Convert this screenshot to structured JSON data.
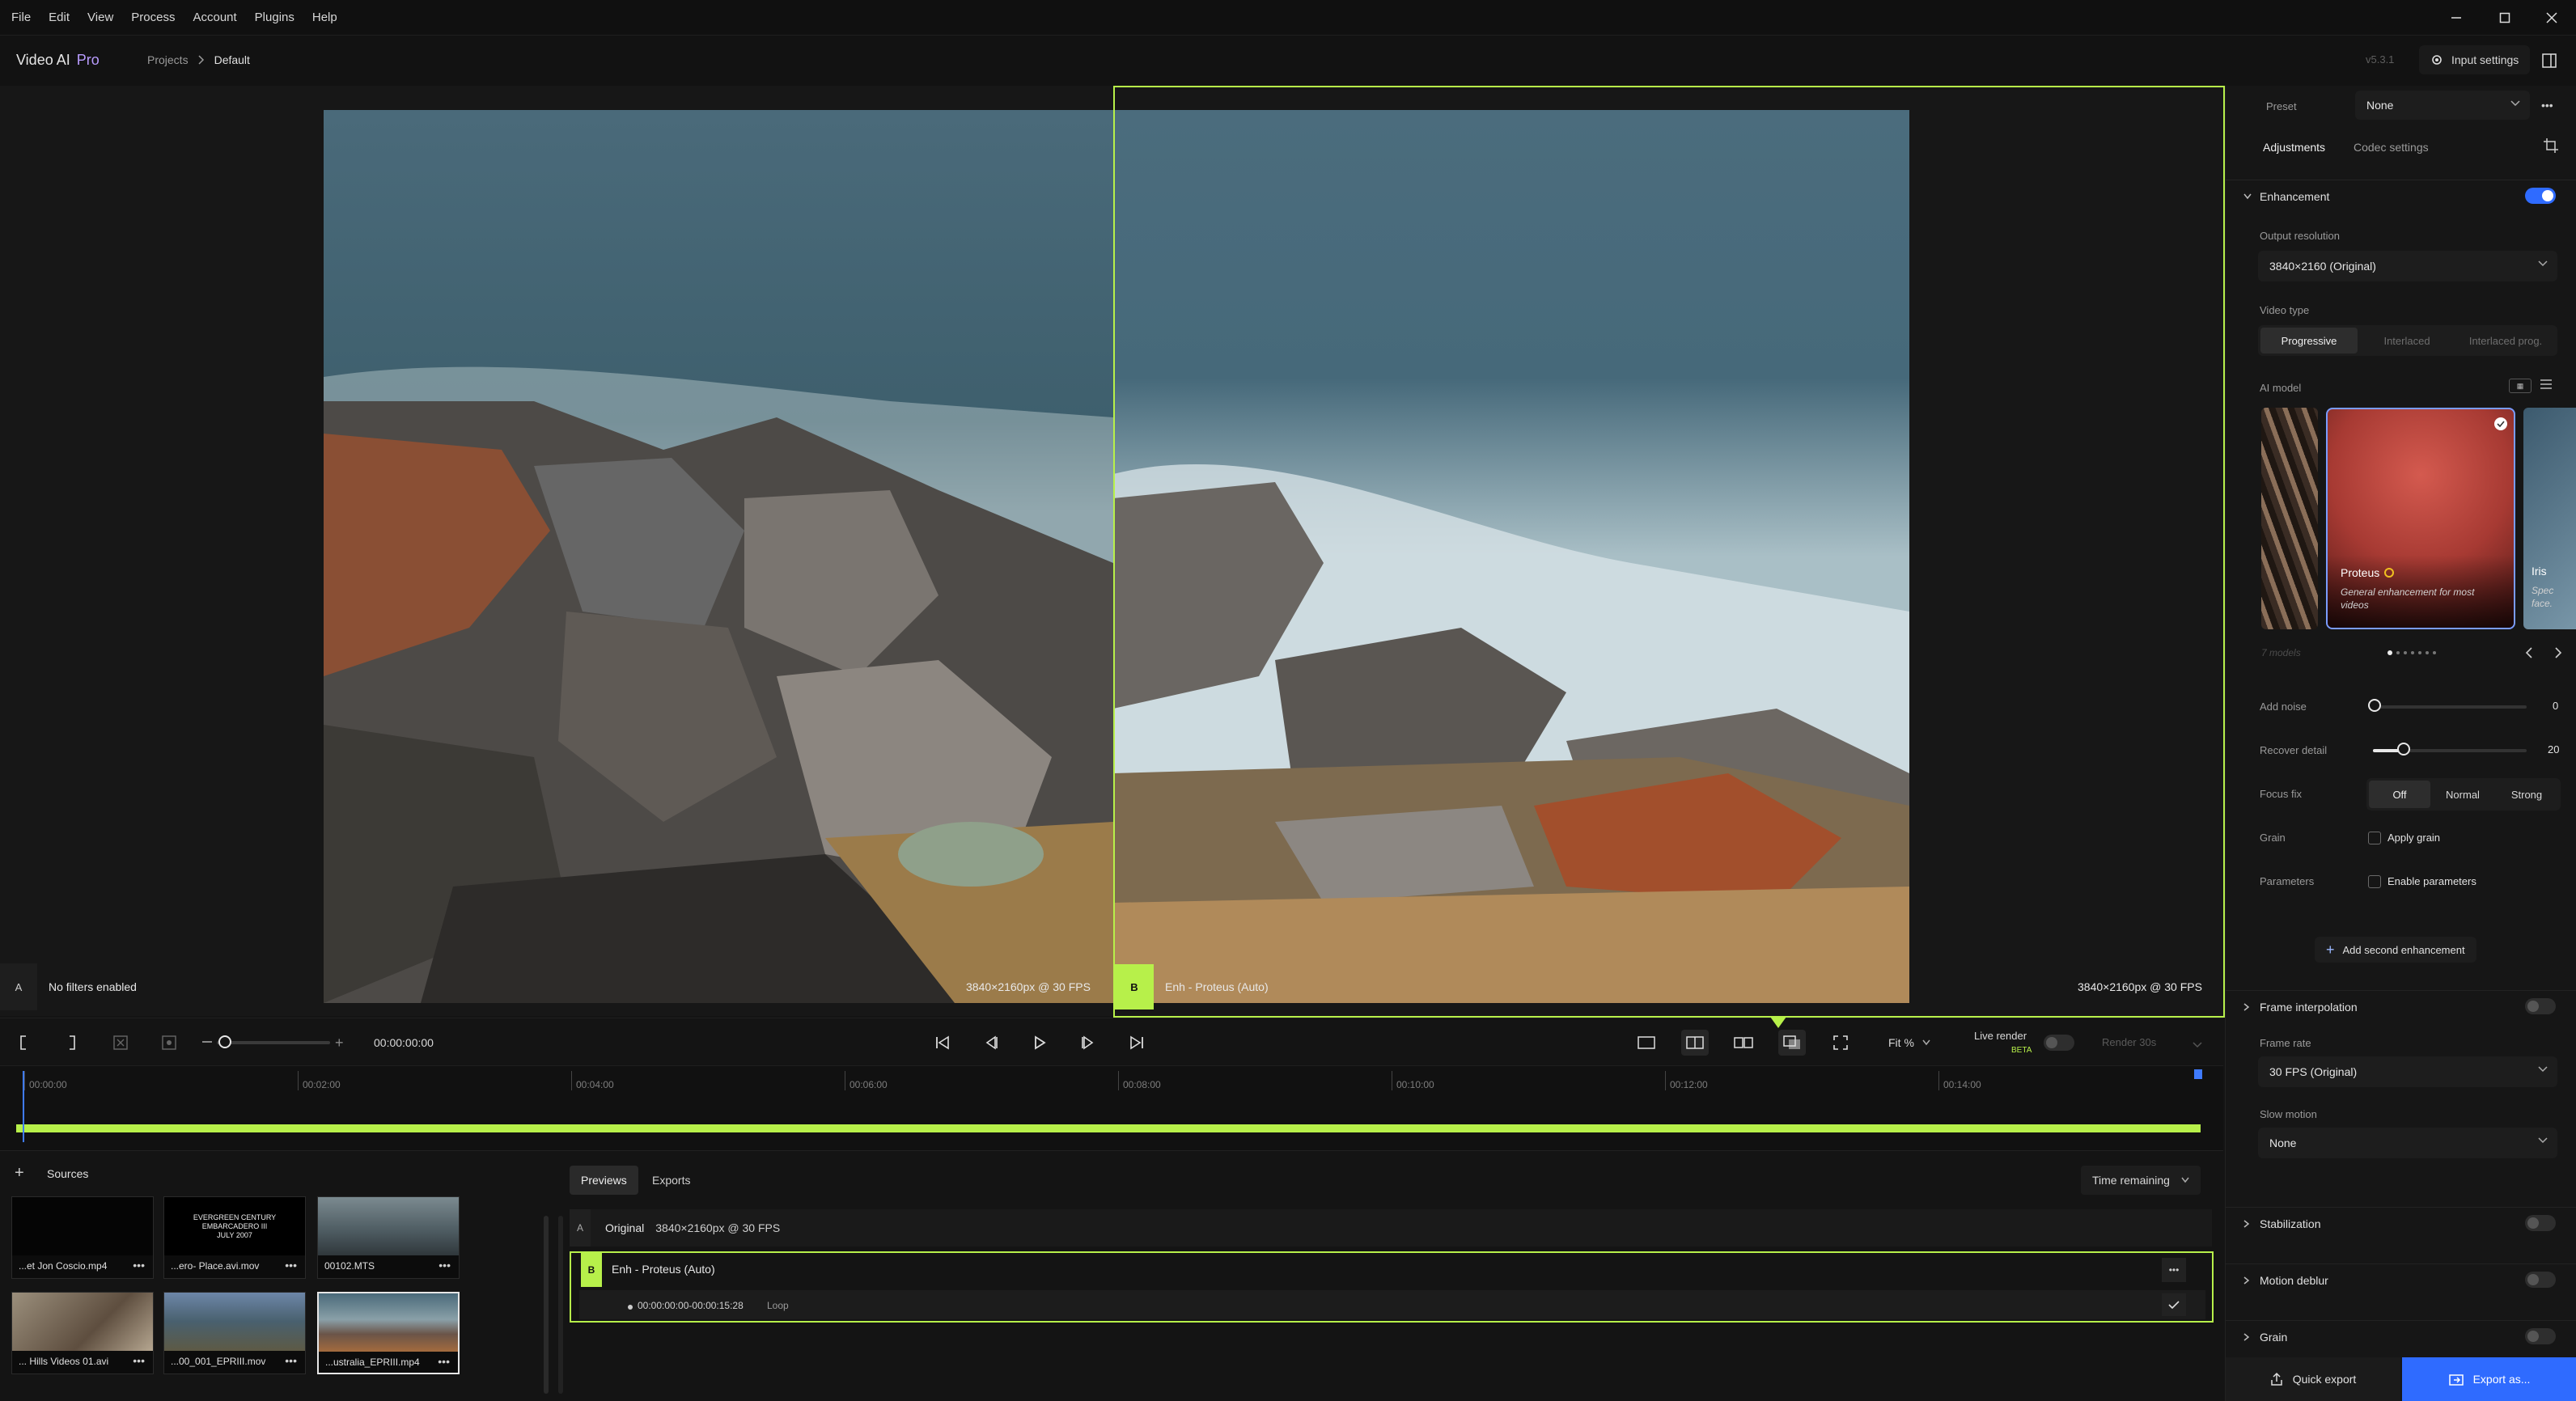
{
  "menu": [
    "File",
    "Edit",
    "View",
    "Process",
    "Account",
    "Plugins",
    "Help"
  ],
  "app": {
    "name": "Video AI",
    "edition": "Pro",
    "version": "v5.3.1"
  },
  "breadcrumb": {
    "root": "Projects",
    "current": "Default"
  },
  "header": {
    "input_settings": "Input settings"
  },
  "viewer": {
    "left_tag": "A",
    "left_label": "No filters enabled",
    "left_info": "3840×2160px @ 30 FPS",
    "right_tag": "B",
    "right_label": "Enh - Proteus (Auto)",
    "right_info": "3840×2160px @ 30 FPS"
  },
  "transport": {
    "timecode": "00:00:00:00",
    "fit": "Fit %",
    "live_render": "Live render",
    "beta": "BETA",
    "render": "Render 30s"
  },
  "timeline": {
    "ticks": [
      "00:00:00",
      "00:02:00",
      "00:04:00",
      "00:06:00",
      "00:08:00",
      "00:10:00",
      "00:12:00",
      "00:14:00"
    ]
  },
  "sources": {
    "title": "Sources",
    "items": [
      {
        "name": "...et Jon Coscio.mp4"
      },
      {
        "name": "...ero- Place.avi.mov",
        "overlay": "EVERGREEN CENTURY\nEMBARCADERO III\nJULY 2007"
      },
      {
        "name": "00102.MTS"
      },
      {
        "name": "... Hills Videos 01.avi"
      },
      {
        "name": "...00_001_EPRIII.mov"
      },
      {
        "name": "...ustralia_EPRIII.mp4"
      }
    ]
  },
  "queue": {
    "tabs": [
      "Previews",
      "Exports"
    ],
    "sort": "Time remaining",
    "rows": [
      {
        "tag": "A",
        "title": "Original",
        "meta": "3840×2160px @ 30 FPS"
      },
      {
        "tag": "B",
        "title": "Enh - Proteus (Auto)",
        "range": "00:00:00:00-00:00:15:28",
        "loop": "Loop"
      }
    ]
  },
  "panel": {
    "preset_label": "Preset",
    "preset_value": "None",
    "tabs": [
      "Adjustments",
      "Codec settings"
    ],
    "enhancement": "Enhancement",
    "output_resolution_label": "Output resolution",
    "output_resolution": "3840×2160 (Original)",
    "video_type_label": "Video type",
    "video_types": [
      "Progressive",
      "Interlaced",
      "Interlaced prog."
    ],
    "ai_model_label": "AI model",
    "model_name": "Proteus",
    "model_desc": "General enhancement for most videos",
    "next_model": "Iris",
    "next_model_desc": "Spec face.",
    "models_count": "7 models",
    "add_noise": "Add noise",
    "add_noise_val": "0",
    "recover_detail": "Recover detail",
    "recover_detail_val": "20",
    "focus_fix": "Focus fix",
    "focus_options": [
      "Off",
      "Normal",
      "Strong"
    ],
    "grain": "Grain",
    "apply_grain": "Apply grain",
    "parameters": "Parameters",
    "enable_parameters": "Enable parameters",
    "add_second": "Add second enhancement",
    "frame_interp": "Frame interpolation",
    "frame_rate_label": "Frame rate",
    "frame_rate": "30 FPS (Original)",
    "slow_motion_label": "Slow motion",
    "slow_motion": "None",
    "stabilization": "Stabilization",
    "motion_deblur": "Motion deblur",
    "grain_section": "Grain",
    "quick_export": "Quick export",
    "export_as": "Export as..."
  },
  "colors": {
    "accent": "#b7f04a",
    "primary": "#2f6bff"
  }
}
